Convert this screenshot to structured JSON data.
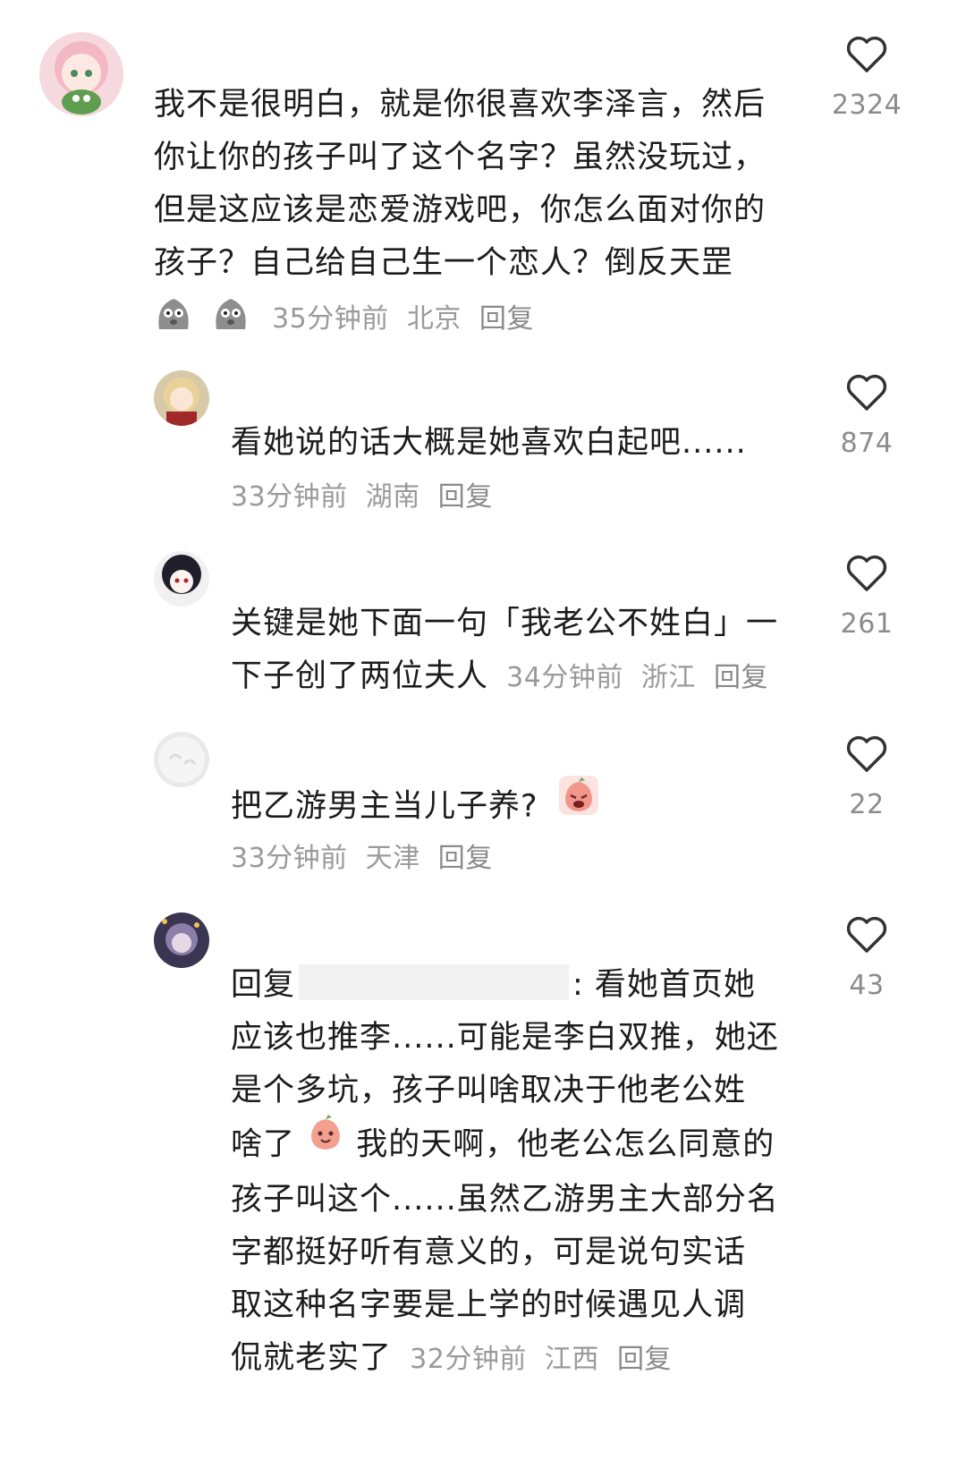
{
  "comments": [
    {
      "text_lines": [
        "我不是很明白，就是你很喜欢李泽言，然后",
        "你让你的孩子叫了这个名字？虽然没玩过，",
        "但是这应该是恋爱游戏吧，你怎么面对你的",
        "孩子？自己给自己生一个恋人？倒反天罡"
      ],
      "time": "35分钟前",
      "location": "北京",
      "reply": "回复",
      "likes": "2324"
    },
    {
      "text_lines": [
        "看她说的话大概是她喜欢白起吧......"
      ],
      "time": "33分钟前",
      "location": "湖南",
      "reply": "回复",
      "likes": "874"
    },
    {
      "text_lines": [
        "关键是她下面一句「我老公不姓白」一",
        "下子创了两位夫人"
      ],
      "time": "34分钟前",
      "location": "浙江",
      "reply": "回复",
      "likes": "261"
    },
    {
      "text": "把乙游男主当儿子养?",
      "time": "33分钟前",
      "location": "天津",
      "reply": "回复",
      "likes": "22"
    },
    {
      "reply_prefix": "回复",
      "line1_after": ": 看她首页她",
      "lines_mid": [
        "应该也推李......可能是李白双推，她还",
        "是个多坑，孩子叫啥取决于他老公姓"
      ],
      "line4_before": "啥了",
      "line4_after": "我的天啊，他老公怎么同意的",
      "lines_end": [
        "孩子叫这个......虽然乙游男主大部分名",
        "字都挺好听有意义的，可是说句实话",
        "取这种名字要是上学的时候遇见人调"
      ],
      "last_line": "侃就老实了",
      "time": "32分钟前",
      "location": "江西",
      "reply": "回复",
      "likes": "43"
    }
  ],
  "icons": {
    "like": "heart-outline-icon",
    "sticker": "gray-blob-sticker-icon",
    "emoji_cry": "crying-peach-emoji-icon",
    "emoji_smile": "peach-emoji-icon"
  }
}
